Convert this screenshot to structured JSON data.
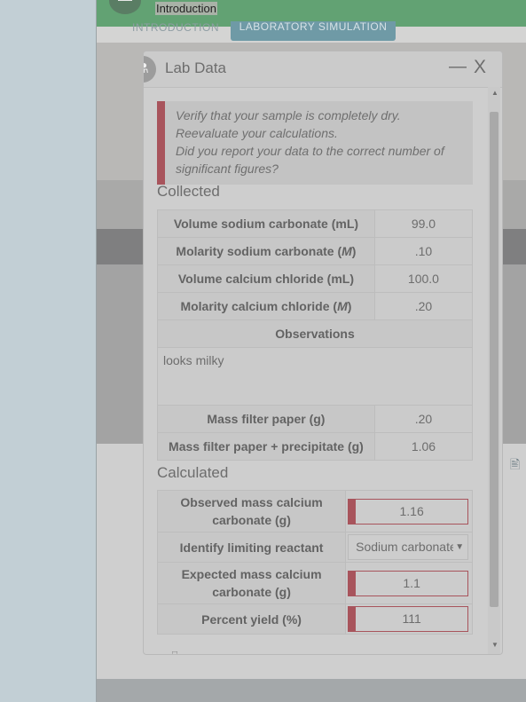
{
  "nav": {
    "title": "Introduction"
  },
  "tabs": [
    {
      "label": "INTRODUCTION"
    },
    {
      "label": "LABORATORY SIMULATION"
    }
  ],
  "modal": {
    "title": "Lab Data",
    "minimize_label": "—",
    "close_label": "X",
    "alert_lines": [
      "Verify that your sample is completely dry.",
      "Reevaluate your calculations.",
      "Did you report your data to the correct number of significant figures?"
    ],
    "collected": {
      "heading": "Collected",
      "rows": [
        {
          "label": "Volume sodium carbonate (mL)",
          "value": "99.0"
        },
        {
          "label": "Molarity sodium carbonate",
          "unit": "M",
          "value": ".10"
        },
        {
          "label": "Volume calcium chloride (mL)",
          "value": "100.0"
        },
        {
          "label": "Molarity calcium chloride",
          "unit": "M",
          "value": ".20"
        }
      ],
      "observations_header": "Observations",
      "observations_value": "looks milky",
      "rows2": [
        {
          "label": "Mass filter paper (g)",
          "value": ".20"
        },
        {
          "label": "Mass filter paper + precipitate (g)",
          "value": "1.06"
        }
      ]
    },
    "calculated": {
      "heading": "Calculated",
      "rows": [
        {
          "label": "Observed mass calcium carbonate (g)",
          "value": "1.16"
        },
        {
          "label": "Identify limiting reactant",
          "value": "Sodium carbonate"
        },
        {
          "label": "Expected mass calcium carbonate (g)",
          "value": "1.1"
        },
        {
          "label": "Percent yield (%)",
          "value": "111"
        }
      ]
    }
  },
  "colors": {
    "nav_green": "#62a273",
    "tab_active": "#6f9aa6",
    "error_red": "#a8545c"
  },
  "icons": {
    "menu": "hamburger-icon",
    "flask": "flask-icon",
    "doc": "document-icon"
  }
}
